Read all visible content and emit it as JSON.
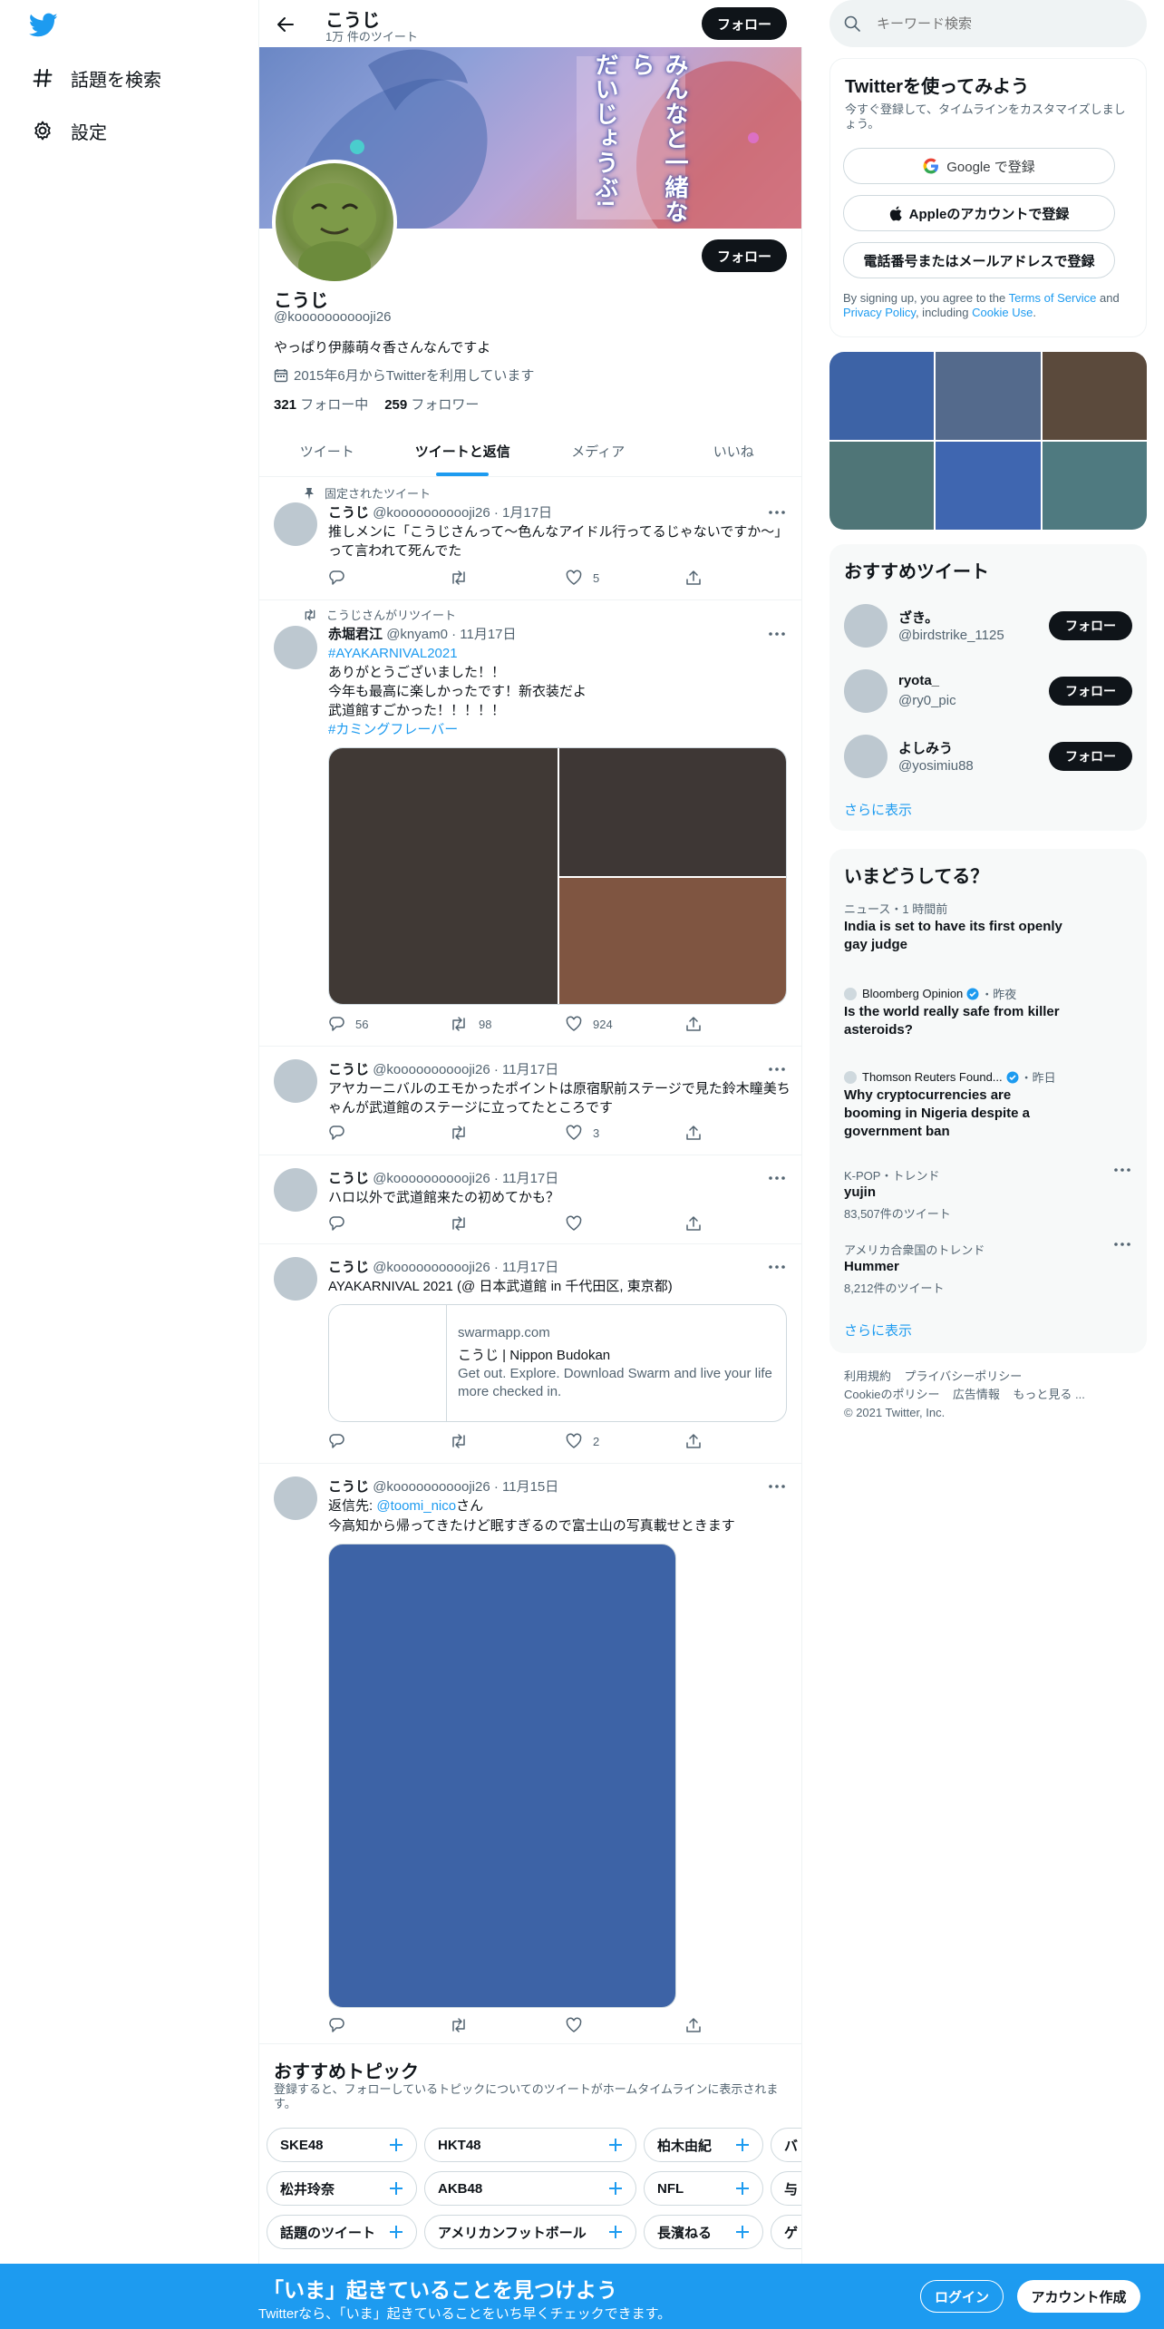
{
  "nav": {
    "explore_label": "話題を検索",
    "settings_label": "設定"
  },
  "header": {
    "title": "こうじ",
    "tweet_count": "1万 件のツイート",
    "follow_label": "フォロー"
  },
  "banner": {
    "text_line1": "みんなと一緒なら",
    "text_line2": "だいじょうぶ!"
  },
  "profile": {
    "name": "こうじ",
    "handle": "@kooooooooooji26",
    "bio": "やっぱり伊藤萌々香さんなんですよ",
    "joined": "2015年6月からTwitterを利用しています",
    "following_count": "321",
    "following_label": "フォロー中",
    "followers_count": "259",
    "followers_label": "フォロワー",
    "follow_label": "フォロー"
  },
  "tabs": [
    "ツイート",
    "ツイートと返信",
    "メディア",
    "いいね"
  ],
  "tweets": [
    {
      "context": "固定されたツイート",
      "name": "こうじ",
      "handle": "@kooooooooooji26",
      "date": "· 1月17日",
      "text": "推しメンに「こうじさんって〜色んなアイドル行ってるじゃないですか〜」って言われて死んでた",
      "reply": "",
      "retweet": "",
      "like": "5"
    },
    {
      "context": "こうじさんがリツイート",
      "name": "赤堀君江",
      "handle": "@knyam0",
      "date": "· 11月17日",
      "hashtag1": "#AYAKARNIVAL2021",
      "line1": "ありがとうございました！！",
      "line2": "今年も最高に楽しかったです！新衣装だよ",
      "line3": "武道館すごかった！！！！！",
      "hashtag2": "#カミングフレーバー",
      "reply": "56",
      "retweet": "98",
      "like": "924"
    },
    {
      "name": "こうじ",
      "handle": "@kooooooooooji26",
      "date": "· 11月17日",
      "text": "アヤカーニバルのエモかったポイントは原宿駅前ステージで見た鈴木瞳美ちゃんが武道館のステージに立ってたところです",
      "like": "3"
    },
    {
      "name": "こうじ",
      "handle": "@kooooooooooji26",
      "date": "· 11月17日",
      "text": "ハロ以外で武道館来たの初めてかも？"
    },
    {
      "name": "こうじ",
      "handle": "@kooooooooooji26",
      "date": "· 11月17日",
      "text": "AYAKARNIVAL 2021 (@ 日本武道館 in 千代田区, 東京都)",
      "card_domain": "swarmapp.com",
      "card_title": "こうじ | Nippon Budokan",
      "card_desc": "Get out. Explore. Download Swarm and live your life more checked in.",
      "like": "2"
    },
    {
      "name": "こうじ",
      "handle": "@kooooooooooji26",
      "date": "· 11月15日",
      "reply_prefix": "返信先: ",
      "reply_to": "@toomi_nico",
      "reply_suffix": "さん",
      "text": "今高知から帰ってきたけど眠すぎるので富士山の写真載せときます"
    }
  ],
  "topics": {
    "title": "おすすめトピック",
    "desc": "登録すると、フォローしているトピックについてのツイートがホームタイムラインに表示されます。",
    "row1": [
      "SKE48",
      "HKT48",
      "柏木由紀",
      "バ"
    ],
    "row2": [
      "松井玲奈",
      "AKB48",
      "NFL",
      "与"
    ],
    "row3": [
      "話題のツイート",
      "アメリカンフットボール",
      "長濱ねる",
      "ゲ"
    ]
  },
  "search": {
    "placeholder": "キーワード検索"
  },
  "signup": {
    "title": "Twitterを使ってみよう",
    "desc": "今すぐ登録して、タイムラインをカスタマイズしましょう。",
    "google": "Google で登録",
    "apple": "Appleのアカウントで登録",
    "phone": "電話番号またはメールアドレスで登録",
    "legal1": "By signing up, you agree to the ",
    "tos": "Terms of Service",
    "and": " and ",
    "privacy": "Privacy Policy",
    "including": ", including ",
    "cookie": "Cookie Use",
    "period": "."
  },
  "media_grid_colors": [
    "#3d63a6",
    "#546a8c",
    "#5b4a3c",
    "#4f7577",
    "#3f66b0",
    "#4f7a80"
  ],
  "recommended": {
    "title": "おすすめツイート",
    "users": [
      {
        "name": "ざき。",
        "handle": "@birdstrike_1125",
        "follow": "フォロー"
      },
      {
        "name": "ryota_",
        "handle": "@ry0_pic",
        "follow": "フォロー"
      },
      {
        "name": "よしみう",
        "handle": "@yosimiu88",
        "follow": "フォロー"
      }
    ],
    "more": "さらに表示"
  },
  "trends": {
    "title": "いまどうしてる？",
    "items": [
      {
        "meta": "ニュース・1 時間前",
        "text": "India is set to have its first openly gay judge"
      },
      {
        "source": "Bloomberg Opinion",
        "time": "・昨夜",
        "text": "Is the world really safe from killer asteroids?"
      },
      {
        "source": "Thomson Reuters Found...",
        "time": "・昨日",
        "text": "Why cryptocurrencies are booming in Nigeria despite a government ban"
      },
      {
        "meta": "K-POP・トレンド",
        "text": "yujin",
        "count": "83,507件のツイート"
      },
      {
        "meta": "アメリカ合衆国のトレンド",
        "text": "Hummer",
        "count": "8,212件のツイート"
      }
    ],
    "more": "さらに表示"
  },
  "footer": {
    "terms": "利用規約",
    "privacy": "プライバシーポリシー",
    "cookie": "Cookieのポリシー",
    "ads": "広告情報",
    "more": "もっと見る ...",
    "copyright": "© 2021 Twitter, Inc."
  },
  "bottombar": {
    "headline": "「いま」起きていることを見つけよう",
    "sub": "Twitterなら、「いま」起きていることをいち早くチェックできます。",
    "login": "ログイン",
    "signup": "アカウント作成"
  },
  "colors": {
    "accent": "#1d9bf0",
    "text": "#0f1419",
    "muted": "#536471"
  }
}
